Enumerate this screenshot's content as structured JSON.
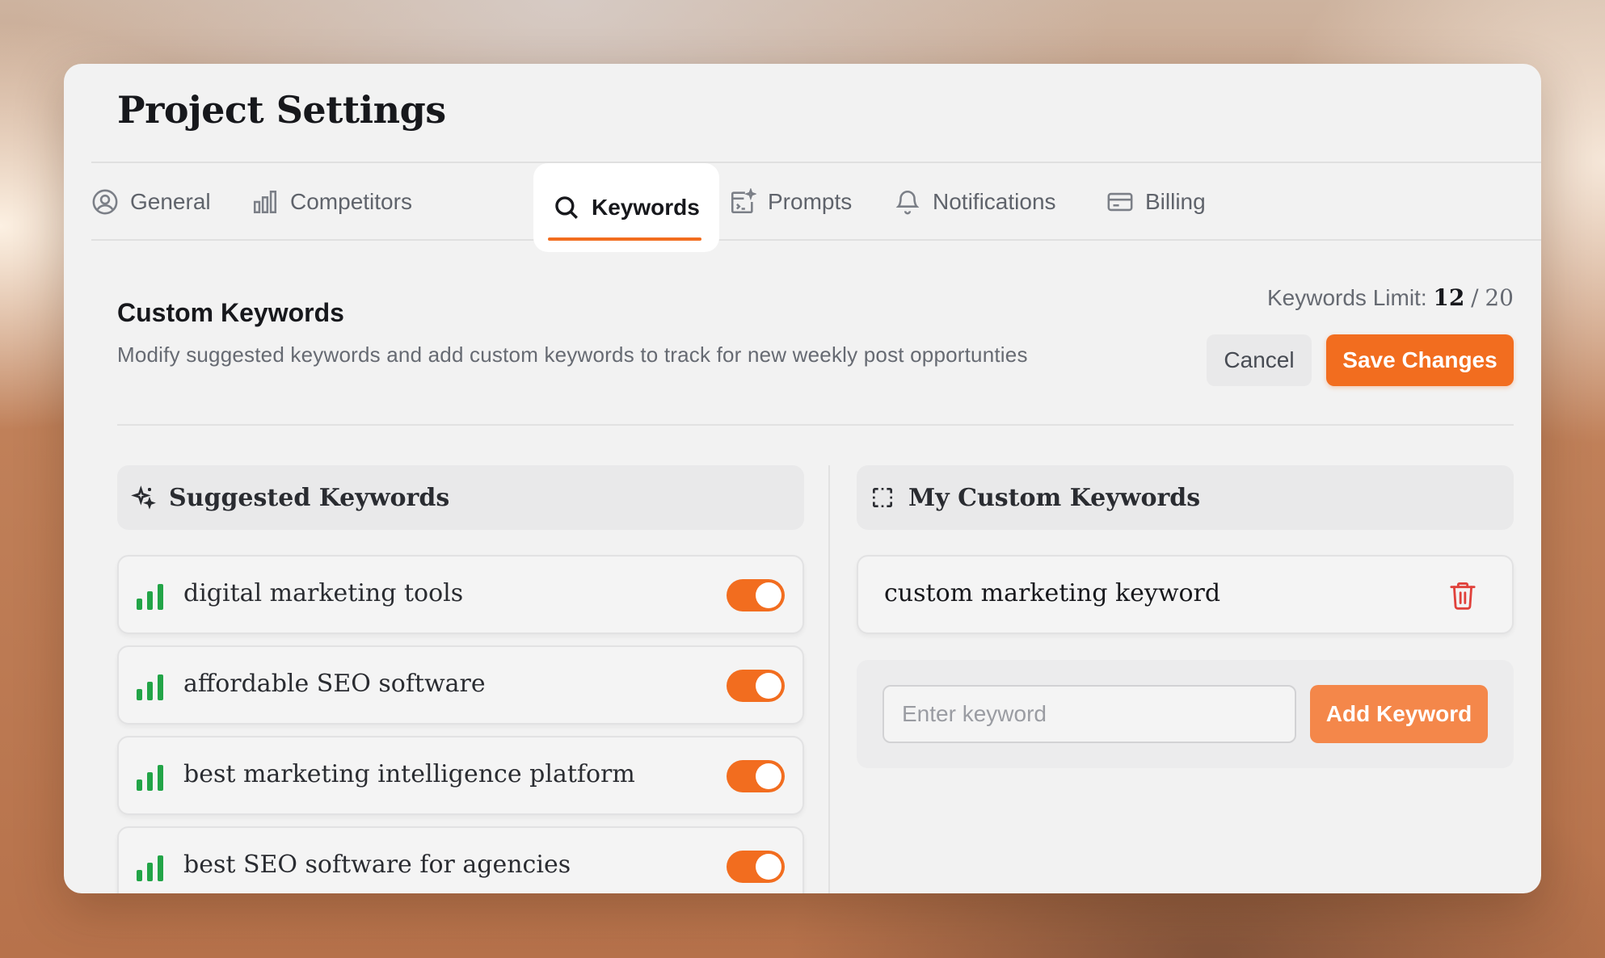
{
  "page": {
    "title": "Project Settings"
  },
  "tabs": [
    {
      "label": "General",
      "icon": "user-circle-icon"
    },
    {
      "label": "Competitors",
      "icon": "bar-chart-icon"
    },
    {
      "label": "Keywords",
      "icon": "search-icon",
      "active": true
    },
    {
      "label": "Prompts",
      "icon": "terminal-sparkle-icon"
    },
    {
      "label": "Notifications",
      "icon": "bell-icon"
    },
    {
      "label": "Billing",
      "icon": "credit-card-icon"
    }
  ],
  "section": {
    "title": "Custom Keywords",
    "description": "Modify suggested keywords and add custom keywords to track for new weekly post opportunties",
    "limit_label": "Keywords Limit:",
    "limit_used": "12",
    "limit_separator": "/",
    "limit_total": "20",
    "cancel_label": "Cancel",
    "save_label": "Save Changes"
  },
  "suggested": {
    "title": "Suggested Keywords",
    "icon": "sparkles-icon",
    "items": [
      {
        "label": "digital marketing tools",
        "enabled": true
      },
      {
        "label": "affordable SEO software",
        "enabled": true
      },
      {
        "label": "best marketing intelligence platform",
        "enabled": true
      },
      {
        "label": "best SEO software for agencies",
        "enabled": true
      }
    ]
  },
  "custom": {
    "title": "My Custom Keywords",
    "icon": "dashed-square-icon",
    "items": [
      {
        "label": "custom marketing keyword"
      }
    ],
    "input_placeholder": "Enter keyword",
    "add_label": "Add Keyword"
  },
  "colors": {
    "accent": "#f26d1f",
    "bars": "#22a447",
    "trash": "#e0413b"
  }
}
